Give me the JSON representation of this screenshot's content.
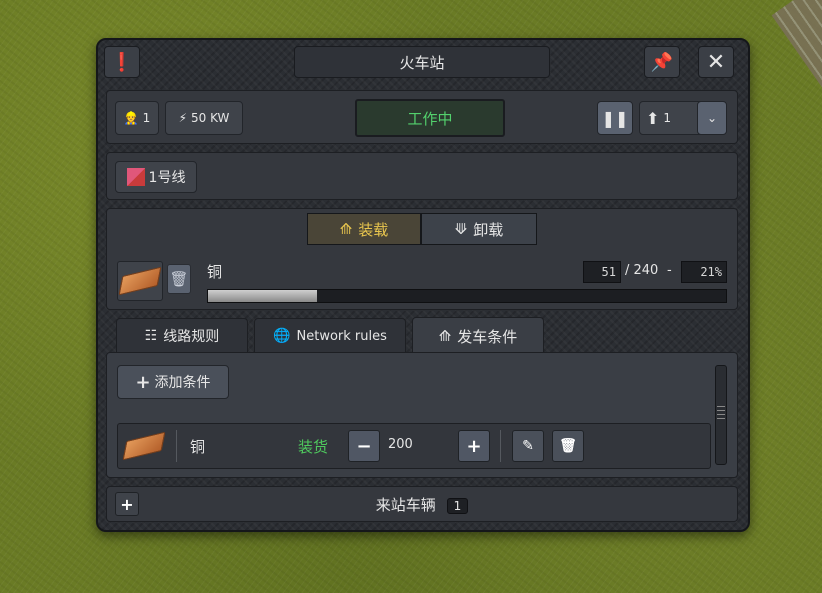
{
  "window": {
    "title": "火车站",
    "pin_icon": "pin-icon",
    "close_icon": "close-icon"
  },
  "header": {
    "workers": "1",
    "power": "50 KW",
    "status": "工作中",
    "priority": "1"
  },
  "line": {
    "color": "#d64b4b",
    "name": "1号线"
  },
  "cargo_mode": {
    "load_label": "装载",
    "unload_label": "卸载",
    "selected": "装载"
  },
  "cargo": {
    "name": "铜",
    "current": "51",
    "capacity": "/ 240",
    "separator": "-",
    "percent": "21%",
    "fill_fraction": 0.21
  },
  "tabs": [
    {
      "label": "线路规则"
    },
    {
      "label": "Network rules"
    },
    {
      "label": "发车条件"
    }
  ],
  "conditions": {
    "add_label": "添加条件",
    "items": [
      {
        "cargo": "铜",
        "action": "装货",
        "amount": "200"
      }
    ]
  },
  "footer": {
    "label": "来站车辆",
    "count": "1"
  },
  "colors": {
    "status_green": "#53d16d",
    "active_yellow": "#e9c64e",
    "action_green": "#4fca5e"
  }
}
